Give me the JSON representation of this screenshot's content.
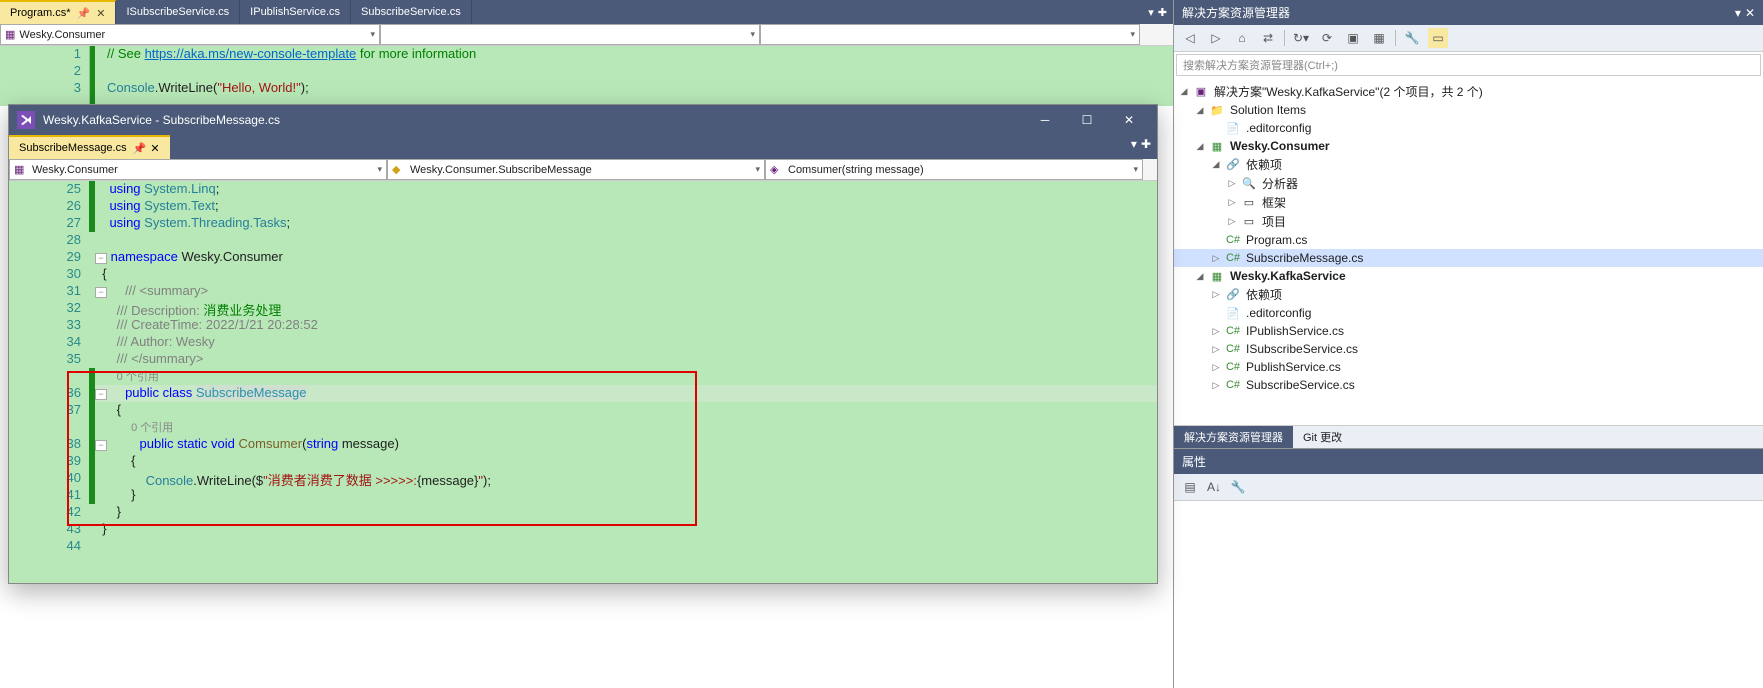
{
  "bg_tabs": [
    {
      "label": "Program.cs*",
      "active": true
    },
    {
      "label": "ISubscribeService.cs",
      "active": false
    },
    {
      "label": "IPublishService.cs",
      "active": false
    },
    {
      "label": "SubscribeService.cs",
      "active": false
    }
  ],
  "bg_drops": {
    "ns": "Wesky.Consumer",
    "cl": "",
    "mb": ""
  },
  "bg_code": {
    "lines": [
      "1",
      "2",
      "3"
    ],
    "comment_prefix": "// See ",
    "link": "https://aka.ms/new-console-template",
    "comment_suffix": " for more information",
    "console": "Console",
    "writeline": ".WriteLine(",
    "hello": "\"Hello, World!\"",
    "close": ");"
  },
  "float": {
    "title": "Wesky.KafkaService - SubscribeMessage.cs",
    "tab": "SubscribeMessage.cs",
    "drops": {
      "ns": "Wesky.Consumer",
      "cl": "Wesky.Consumer.SubscribeMessage",
      "mb": "Comsumer(string message)"
    },
    "code": {
      "lines": [
        "25",
        "26",
        "27",
        "28",
        "29",
        "30",
        "31",
        "32",
        "33",
        "34",
        "35",
        "",
        "36",
        "37",
        "",
        "38",
        "39",
        "40",
        "41",
        "42",
        "43",
        "44"
      ],
      "l25": "using System.Linq;",
      "l26": "using System.Text;",
      "l27": "using System.Threading.Tasks;",
      "l29_ns": "namespace",
      "l29_name": " Wesky.Consumer",
      "l30": "{",
      "l31": "/// <summary>",
      "l32_p": "/// Description: ",
      "l32_t": "消费业务处理",
      "l33": "/// CreateTime: 2022/1/21 20:28:52",
      "l34": "/// Author: Wesky",
      "l35": "/// </summary>",
      "hint1": "0 个引用",
      "l36a": "public class ",
      "l36b": "SubscribeMessage",
      "l37": "{",
      "hint2": "0 个引用",
      "l38a": "public static void ",
      "l38b": "Comsumer",
      "l38c": "(",
      "l38d": "string",
      "l38e": " message)",
      "l39": "{",
      "l40a": "Console",
      "l40b": ".WriteLine($",
      "l40c": "\"消费者消费了数据 >>>>>:",
      "l40d": "{message}",
      "l40e": "\"",
      "l40f": ");",
      "l41": "}",
      "l42": "}",
      "l43": "}"
    }
  },
  "solution_explorer": {
    "title": "解决方案资源管理器",
    "search_ph": "搜索解决方案资源管理器(Ctrl+;)",
    "sln": "解决方案\"Wesky.KafkaService\"(2 个项目，共 2 个)",
    "items": {
      "sol_items": "Solution Items",
      "editorconfig": ".editorconfig",
      "consumer": "Wesky.Consumer",
      "deps": "依赖项",
      "analyzers": "分析器",
      "frameworks": "框架",
      "projects": "项目",
      "program": "Program.cs",
      "submsg": "SubscribeMessage.cs",
      "kafka": "Wesky.KafkaService",
      "deps2": "依赖项",
      "editorconfig2": ".editorconfig",
      "ipub": "IPublishService.cs",
      "isub": "ISubscribeService.cs",
      "pub": "PublishService.cs",
      "sub": "SubscribeService.cs"
    },
    "bottom_tabs": {
      "se": "解决方案资源管理器",
      "git": "Git 更改"
    }
  },
  "properties": {
    "title": "属性"
  }
}
